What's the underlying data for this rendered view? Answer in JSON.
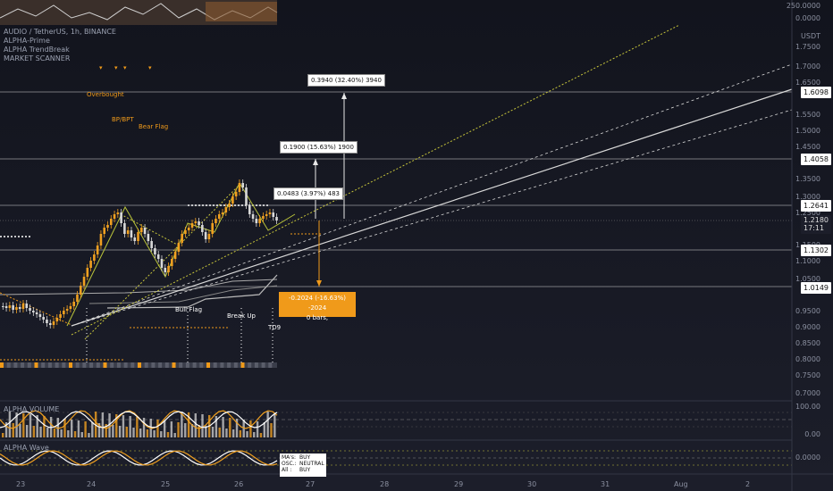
{
  "legend": {
    "symbol": "AUDIO / TetherUS, 1h, BINANCE",
    "indicators": [
      "ALPHA-Prime",
      "ALPHA TrendBreak",
      "MARKET SCANNER"
    ]
  },
  "price_axis": {
    "unit": "USDT",
    "top_labels": [
      "250.0000",
      "0.0000"
    ],
    "labels": [
      "1.7500",
      "1.7000",
      "1.6500",
      "1.5500",
      "1.5000",
      "1.4500",
      "1.3500",
      "1.3000",
      "1.2500",
      "1.1500",
      "1.1000",
      "1.0500",
      "0.9500",
      "0.9000",
      "0.8500",
      "0.8000",
      "0.7500",
      "0.7000"
    ],
    "highlighted": [
      {
        "value": "1.6098"
      },
      {
        "value": "1.4058"
      },
      {
        "value": "1.2641"
      },
      {
        "value": "1.2180",
        "sub": "17:11"
      },
      {
        "value": "1.1302"
      },
      {
        "value": "1.0149"
      }
    ],
    "volume_labels": [
      "100.00",
      "0.00"
    ],
    "wave_label": "0.0000"
  },
  "time_axis": [
    "23",
    "24",
    "25",
    "26",
    "27",
    "28",
    "29",
    "30",
    "31",
    "Aug",
    "2"
  ],
  "measure_boxes": [
    {
      "text": "0.3940 (32.40%) 3940"
    },
    {
      "text": "0.1900 (15.63%) 1900"
    },
    {
      "text": "0.0483 (3.97%) 483"
    }
  ],
  "orange_box": {
    "line1": "-0.2024 (-16.63%) -2024",
    "line2": "0 bars,"
  },
  "annotations": {
    "overbought": "Overbought",
    "bpbpt": "BP/BPT",
    "bear_flag": "Bear Flag",
    "bull_flag": "Bull Flag",
    "break_up": "Break Up",
    "td9": "TD9"
  },
  "panels": {
    "volume_title": "ALPHA VOLUME",
    "wave_title": "ALPHA Wave"
  },
  "scanner": {
    "rows": [
      {
        "k": "MA's:",
        "v": "BUY"
      },
      {
        "k": "OSC.:",
        "v": "NEUTRAL"
      },
      {
        "k": "All :",
        "v": "BUY"
      }
    ]
  },
  "colors": {
    "bg": "#0f111a",
    "up": "#f0a020",
    "down": "#d8d8d8",
    "accent": "#f09a1a",
    "trend": "#b8c23a"
  }
}
